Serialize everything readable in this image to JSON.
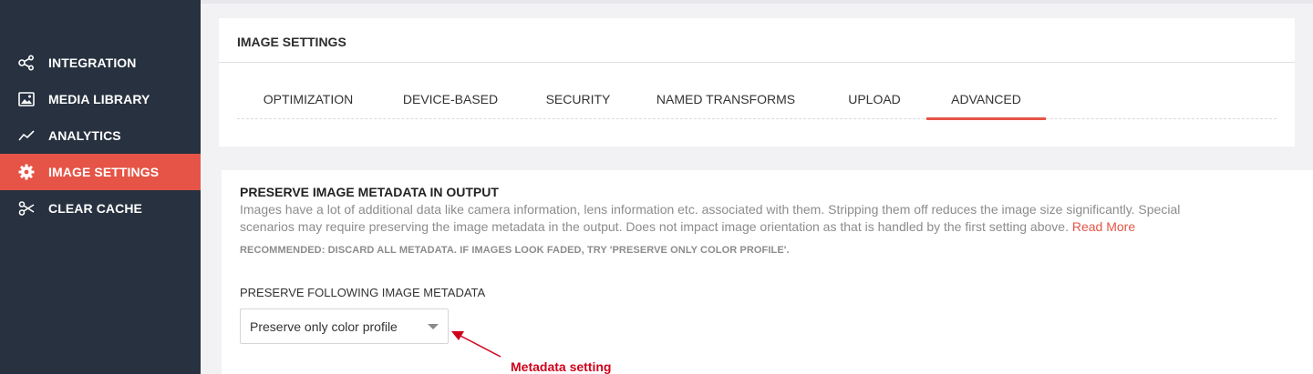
{
  "sidebar": {
    "items": [
      {
        "label": "INTEGRATION",
        "icon": "share-nodes-icon",
        "active": false
      },
      {
        "label": "MEDIA LIBRARY",
        "icon": "image-icon",
        "active": false
      },
      {
        "label": "ANALYTICS",
        "icon": "trend-line-icon",
        "active": false
      },
      {
        "label": "IMAGE SETTINGS",
        "icon": "gear-icon",
        "active": true
      },
      {
        "label": "CLEAR CACHE",
        "icon": "scissors-icon",
        "active": false
      }
    ]
  },
  "card": {
    "title": "IMAGE SETTINGS",
    "tabs": [
      {
        "label": "OPTIMIZATION",
        "active": false
      },
      {
        "label": "DEVICE-BASED",
        "active": false
      },
      {
        "label": "SECURITY",
        "active": false
      },
      {
        "label": "NAMED TRANSFORMS",
        "active": false
      },
      {
        "label": "UPLOAD",
        "active": false
      },
      {
        "label": "ADVANCED",
        "active": true
      }
    ]
  },
  "section": {
    "title": "PRESERVE IMAGE METADATA IN OUTPUT",
    "description": "Images have a lot of additional data like camera information, lens information etc. associated with them. Stripping them off reduces the image size significantly. Special scenarios may require preserving the image metadata in the output. Does not impact image orientation as that is handled by the first setting above.",
    "read_more": "Read More",
    "recommendation": "RECOMMENDED: DISCARD ALL METADATA. IF IMAGES LOOK FADED, TRY 'PRESERVE ONLY COLOR PROFILE'.",
    "field_label": "PRESERVE FOLLOWING IMAGE METADATA",
    "selected_value": "Preserve only color profile"
  },
  "annotation": {
    "label": "Metadata setting",
    "color": "#d0021b"
  },
  "colors": {
    "sidebar_bg": "#27313f",
    "accent": "#e55447"
  }
}
